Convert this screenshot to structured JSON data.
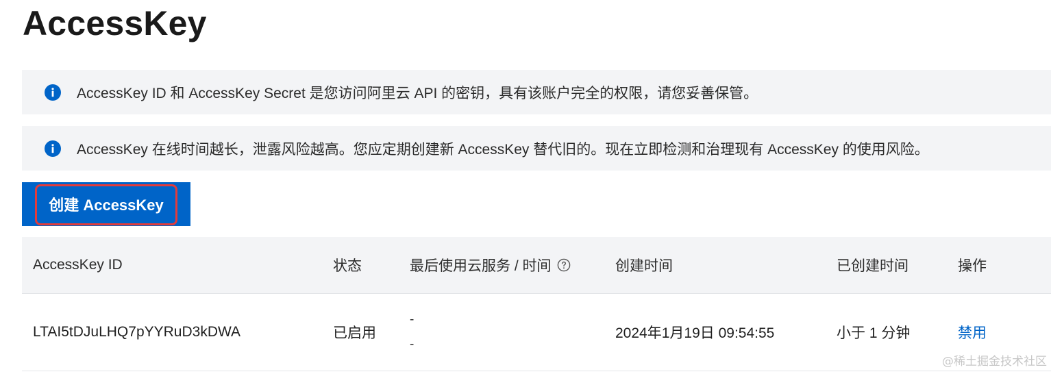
{
  "page": {
    "title": "AccessKey"
  },
  "alerts": [
    {
      "icon": "info-icon",
      "text": "AccessKey ID 和 AccessKey Secret 是您访问阿里云 API 的密钥，具有该账户完全的权限，请您妥善保管。"
    },
    {
      "icon": "info-icon",
      "text": "AccessKey 在线时间越长，泄露风险越高。您应定期创建新 AccessKey 替代旧的。现在立即检测和治理现有 AccessKey 的使用风险。"
    }
  ],
  "toolbar": {
    "create_label": "创建 AccessKey"
  },
  "table": {
    "columns": [
      "AccessKey ID",
      "状态",
      "最后使用云服务 / 时间",
      "创建时间",
      "已创建时间",
      "操作"
    ],
    "rows": [
      {
        "id": "LTAI5tDJuLHQ7pYYRuD3kDWA",
        "status": "已启用",
        "last_used_service": "-",
        "last_used_time": "-",
        "created_at": "2024年1月19日 09:54:55",
        "age": "小于 1 分钟",
        "action": "禁用"
      }
    ]
  },
  "watermark": "@稀土掘金技术社区",
  "colors": {
    "primary": "#0064c8",
    "highlight": "#e23b3b",
    "alert_bg": "#f3f4f6"
  }
}
